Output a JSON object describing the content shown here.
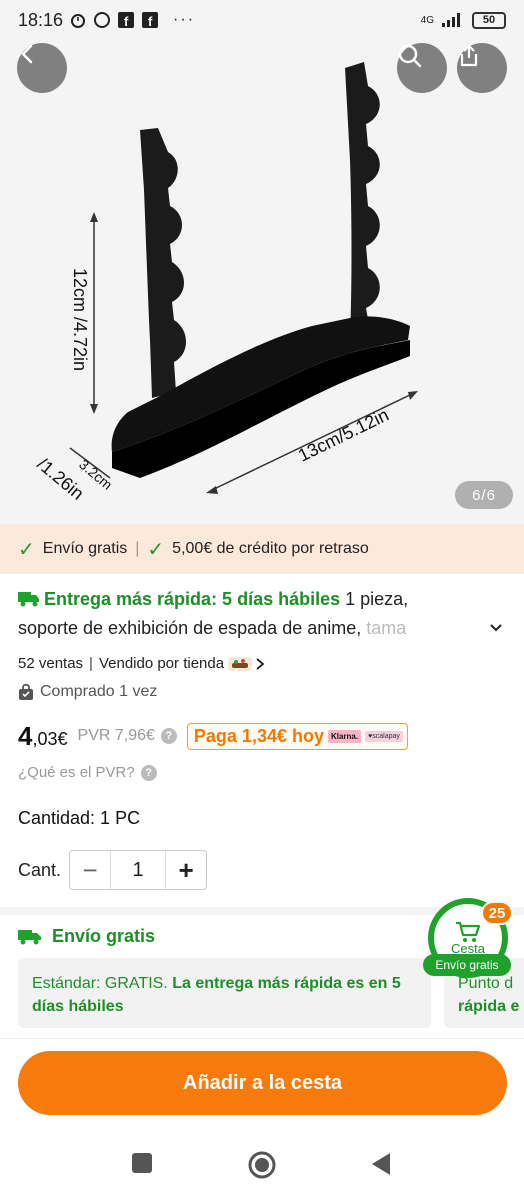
{
  "status_bar": {
    "time": "18:16",
    "network": "4G",
    "battery": "50",
    "more": "···"
  },
  "image": {
    "counter": "6/6",
    "dim_height": "12cm /4.72in",
    "dim_width": "13cm/5.12in",
    "dim_depth_cm": "3.2cm",
    "dim_depth_in": "/1.26in"
  },
  "banner": {
    "free_shipping": "Envío gratis",
    "separator": "|",
    "credit": "5,00€ de crédito por retraso"
  },
  "product": {
    "delivery_fast": "Entrega más rápida: 5 días hábiles",
    "pieces": " 1 pieza,",
    "title": "soporte de exhibición de espada de anime, ",
    "title_fade": "tama",
    "sales": "52 ventas",
    "sales_sep": "|",
    "sold_by": "Vendido por tienda",
    "bought": "Comprado 1 vez",
    "price_int": "4",
    "price_cents": ",03€",
    "pvr": "PVR 7,96€",
    "pay_today": "Paga 1,34€ hoy",
    "klarna": "Klarna.",
    "scalapay": "♥scalapay",
    "pvr_question": "¿Qué es el PVR?",
    "quantity_label": "Cantidad: 1 PC",
    "cant_label": "Cant.",
    "cant_value": "1"
  },
  "shipping": {
    "header": "Envío gratis",
    "standard_prefix": "Estándar: GRATIS. ",
    "standard_bold": "La entrega más rápida es en 5 días hábiles",
    "pickup_line1": "Punto d",
    "pickup_line2": "rápida e"
  },
  "cart": {
    "count": "25",
    "label": "Cesta",
    "free": "Envío gratis"
  },
  "cta": {
    "add_to_cart": "Añadir a la cesta"
  },
  "colors": {
    "accent": "#f77a0c",
    "green": "#1fa22c",
    "banner_bg": "#fde8dc"
  }
}
